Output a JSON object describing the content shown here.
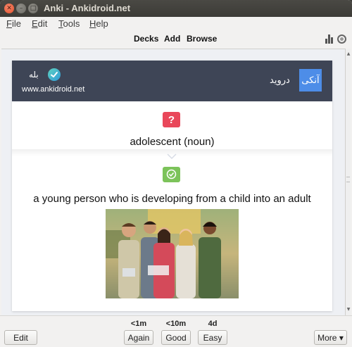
{
  "window": {
    "title": "Anki - Ankidroid.net"
  },
  "menu": {
    "items": [
      {
        "ul": "F",
        "rest": "ile"
      },
      {
        "ul": "E",
        "rest": "dit"
      },
      {
        "ul": "T",
        "rest": "ools"
      },
      {
        "ul": "H",
        "rest": "elp"
      }
    ]
  },
  "toolbar": {
    "decks": "Decks",
    "add": "Add",
    "browse": "Browse",
    "stats_icon": "bar-chart-icon",
    "sync_icon": "sync-icon"
  },
  "card": {
    "header": {
      "brand_tile": "آنکی",
      "brand_name": "درويد",
      "yes_text": "بله",
      "site_url": "www.ankidroid.net",
      "accent": "#3e4556",
      "tile_color": "#4d8de8"
    },
    "question_icon": "?",
    "question": "adolescent (noun)",
    "answer": "a young person who is developing from a child into an adult",
    "question_color": "#e9475a",
    "answer_color": "#7cc35a"
  },
  "bottom": {
    "edit": "Edit",
    "more": "More ▾",
    "answers": [
      {
        "interval": "<1m",
        "label": "Again"
      },
      {
        "interval": "<10m",
        "label": "Good"
      },
      {
        "interval": "4d",
        "label": "Easy"
      }
    ]
  }
}
